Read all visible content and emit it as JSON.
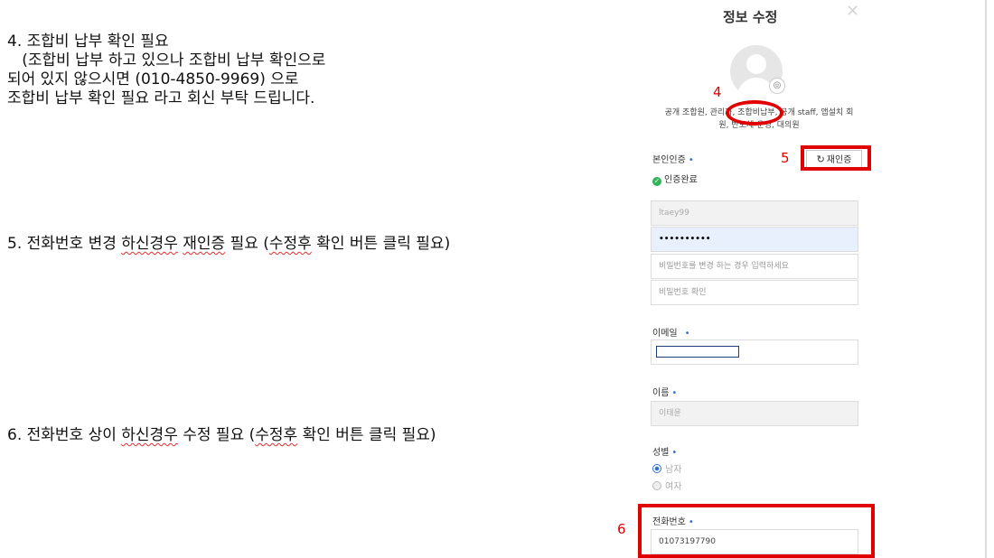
{
  "instructions": {
    "s4_l1": "4. 조합비 납부 확인 필요",
    "s4_l2": "   (조합비 납부 하고 있으나 조합비 납부 확인으로",
    "s4_l3": "되어 있지 않으시면 (010-4850-9969) 으로",
    "s4_l4": "조합비 납부 확인 필요 라고 회신 부탁 드립니다.",
    "s5": "5. 전화번호 변경 하신경우 재인증 필요 (수정후 확인 버튼 클릭 필요)",
    "s6": "6. 전화번호 상이 하신경우 수정 필요 (수정후 확인 버튼 클릭 필요)"
  },
  "modal": {
    "title": "정보 수정",
    "roles_line1": "공개 조합원, 관리자, 조합비납부, 공개 staff, 앱설치 회",
    "roles_line2": "원, 반도체-운영, 대의원",
    "identity_label": "본인인증",
    "reauth_label": "재인증",
    "verified_text": "인증완료",
    "user_id": "ltaey99",
    "password_value": "••••••••••",
    "new_password_placeholder": "비밀번호를 변경 하는 경우 입력하세요",
    "confirm_password_placeholder": "비밀번호 확인",
    "email_label": "이메일",
    "name_label": "이름",
    "name_value": "이태윤",
    "gender_label": "성별",
    "gender_male": "남자",
    "gender_female": "여자",
    "phone_label": "전화번호",
    "phone_value": "01073197790",
    "required_mark": "•"
  },
  "annotations": {
    "n4": "4",
    "n5": "5",
    "n6": "6"
  },
  "colors": {
    "annotation": "#e00000",
    "accent": "#2f6fd8",
    "verified": "#2fb45a"
  }
}
